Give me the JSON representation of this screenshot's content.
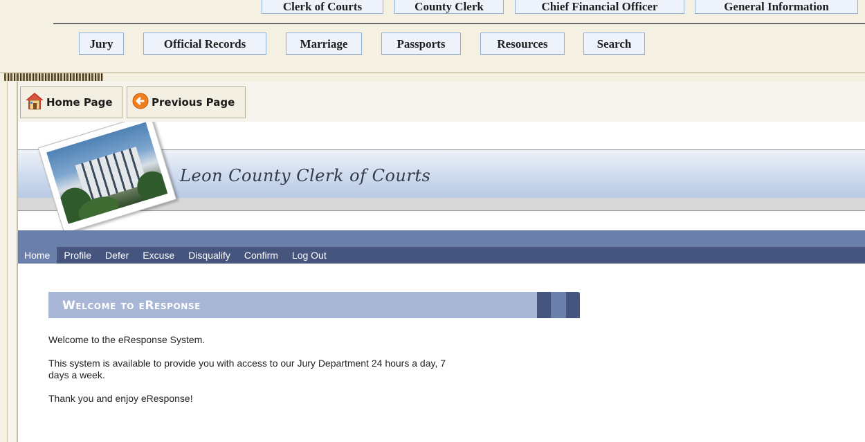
{
  "site_nav": {
    "top_tabs": [
      "Clerk of Courts",
      "County Clerk",
      "Chief Financial Officer",
      "General Information"
    ],
    "sub_tabs": [
      "Jury",
      "Official Records",
      "Marriage",
      "Passports",
      "Resources",
      "Search"
    ]
  },
  "toolbar": {
    "home_label": "Home Page",
    "previous_label": "Previous Page"
  },
  "banner": {
    "title": "Leon County Clerk of Courts"
  },
  "menu": {
    "items": [
      "Home",
      "Profile",
      "Defer",
      "Excuse",
      "Disqualify",
      "Confirm",
      "Log Out"
    ],
    "active": "Home"
  },
  "welcome": {
    "title": "Welcome to eResponse",
    "intro": "Welcome to the eResponse System.",
    "availability_line1": "This system is available to provide you with access to our Jury Department 24 hours a day, 7",
    "availability_line2": "days a week.",
    "closing": "Thank you and enjoy eResponse!"
  },
  "colors": {
    "menu_bar": "#46557e",
    "menu_active": "#6b7fab",
    "welcome_bar": "#a8b7d6",
    "tab_border": "#8fb0d8"
  }
}
